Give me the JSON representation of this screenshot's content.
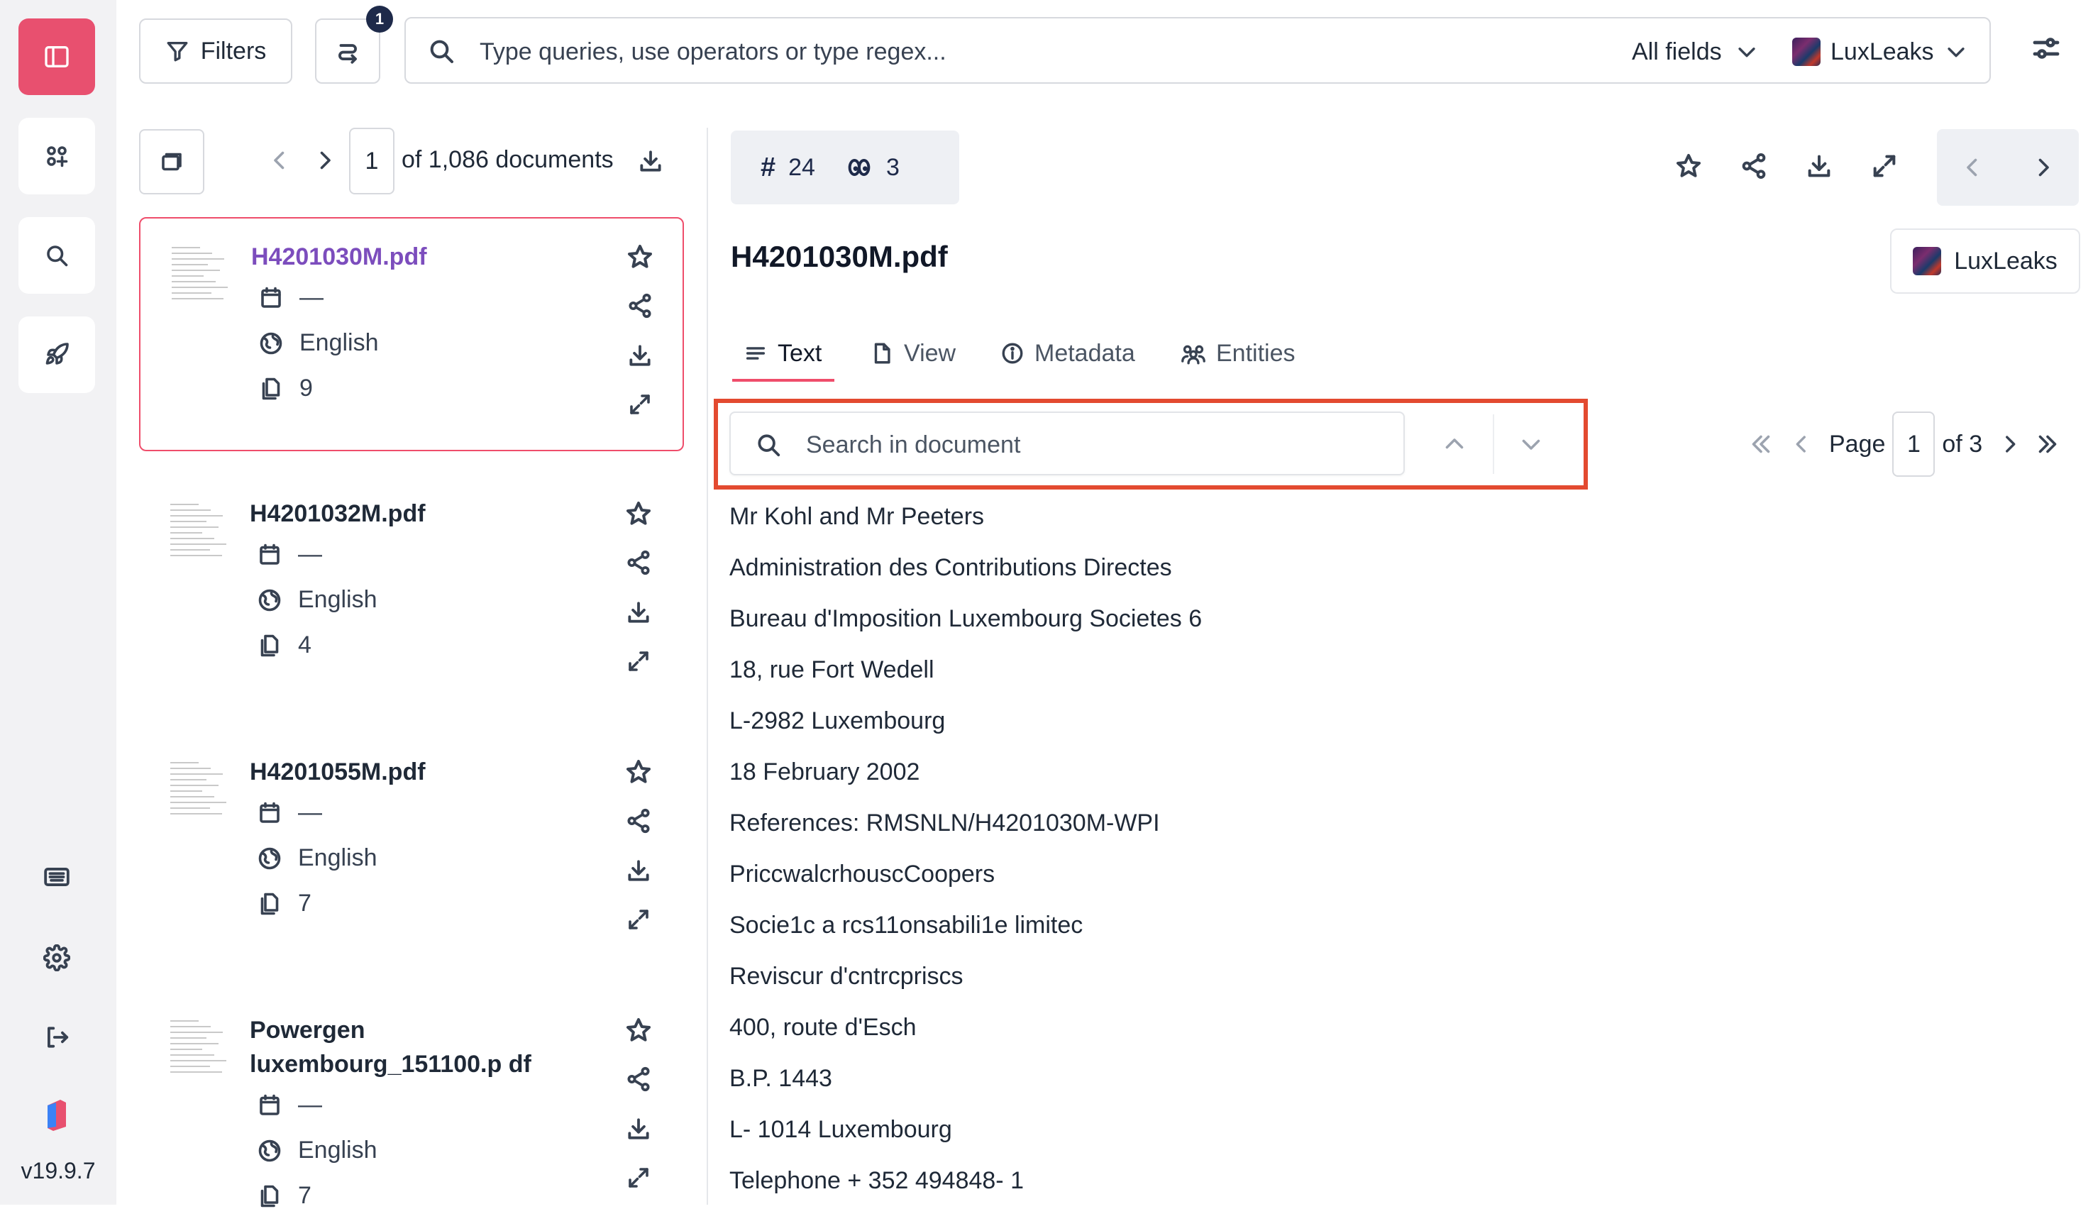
{
  "app": {
    "version": "v19.9.7"
  },
  "topbar": {
    "filters_label": "Filters",
    "batch_count": "1",
    "search_placeholder": "Type queries, use operators or type regex...",
    "fields_label": "All fields",
    "project_label": "LuxLeaks"
  },
  "list": {
    "current_page": "1",
    "total_label": "of 1,086 documents",
    "documents": [
      {
        "title": "H4201030M.pdf",
        "date": "—",
        "language": "English",
        "pages": "9",
        "selected": true
      },
      {
        "title": "H4201032M.pdf",
        "date": "—",
        "language": "English",
        "pages": "4",
        "selected": false
      },
      {
        "title": "H4201055M.pdf",
        "date": "—",
        "language": "English",
        "pages": "7",
        "selected": false
      },
      {
        "title": "Powergen luxembourg_151100.p df",
        "date": "—",
        "language": "English",
        "pages": "7",
        "selected": false
      }
    ]
  },
  "document": {
    "tags_count": "24",
    "recommended_count": "3",
    "title": "H4201030M.pdf",
    "project_label": "LuxLeaks",
    "tabs": [
      "Text",
      "View",
      "Metadata",
      "Entities"
    ],
    "active_tab": "Text",
    "search_placeholder": "Search in document",
    "pager": {
      "label": "Page",
      "current": "1",
      "total_label": "of 3"
    },
    "lines": [
      "Mr Kohl and Mr Peeters",
      "Administration des Contributions Directes",
      "Bureau d'Imposition Luxembourg Societes 6",
      "18, rue Fort Wedell",
      "L-2982 Luxembourg",
      "18 February 2002",
      "References: RMSNLN/H4201030M-WPI",
      "PriccwalcrhouscCoopers",
      "Socie1c a rcs11onsabili1e limitec",
      "Reviscur d'cntrcpriscs",
      "400, route d'Esch",
      "B.P. 1443",
      "L- 1014 Luxembourg",
      "Telephone + 352 494848- 1"
    ]
  },
  "colors": {
    "accent": "#ef4d6b",
    "rail_active": "#e8506f",
    "selected_title": "#7c4dbd",
    "highlight_box": "#e34a30",
    "badge": "#1e2a4a"
  }
}
